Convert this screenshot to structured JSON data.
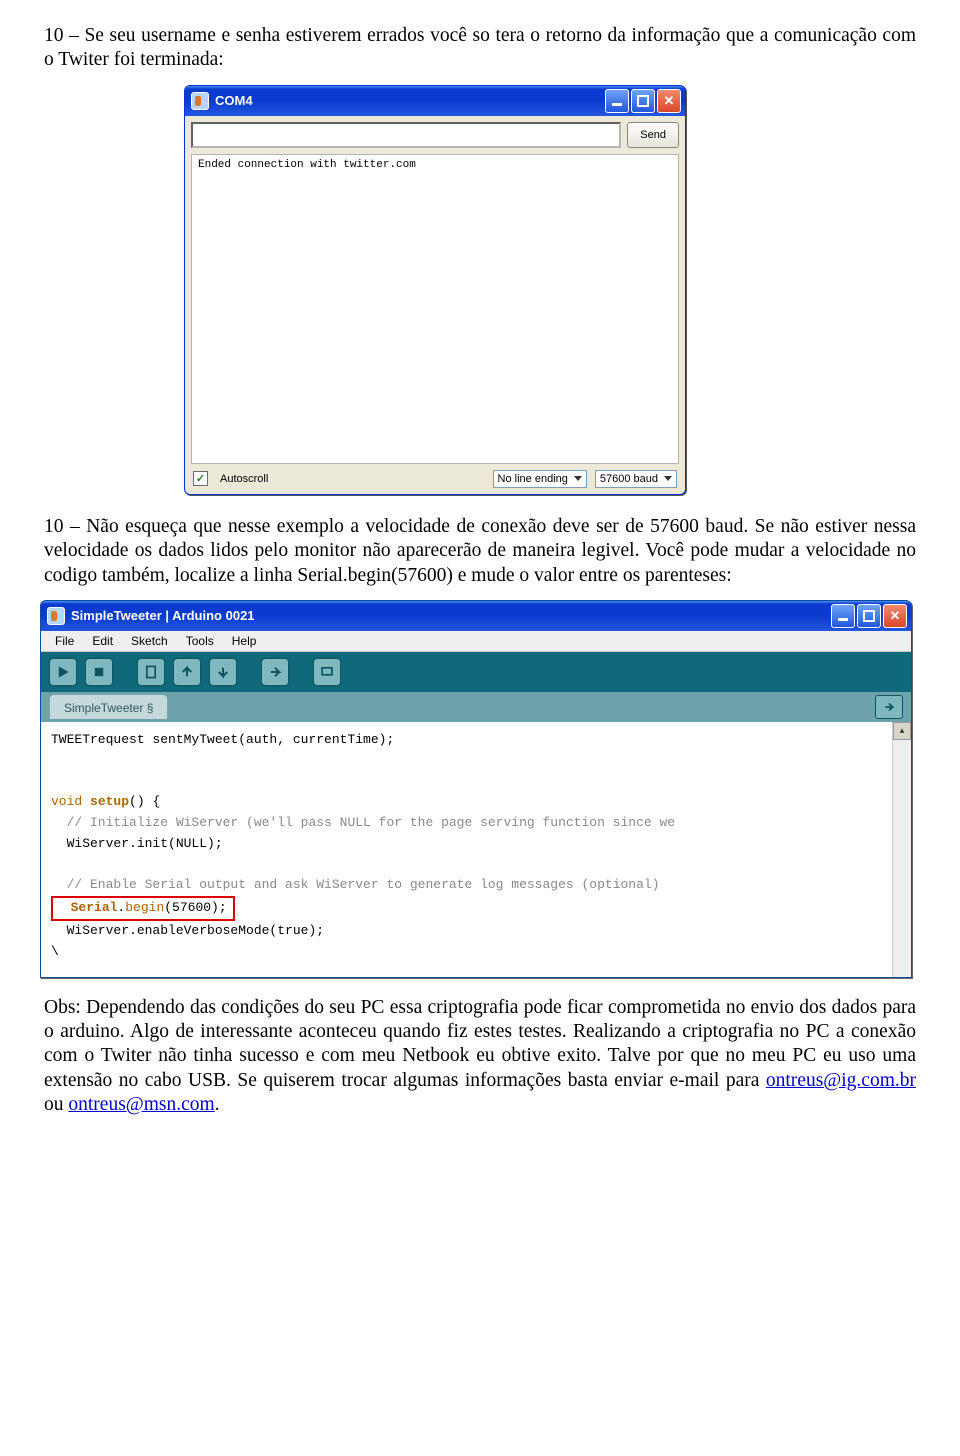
{
  "paragraphs": {
    "p1": "10 – Se seu username e senha estiverem errados você so tera o retorno da informação que a comunicação com o Twiter foi terminada:",
    "p2": "10 – Não esqueça que nesse exemplo a velocidade de conexão deve ser de 57600 baud. Se não estiver nessa velocidade os dados lidos pelo monitor não aparecerão de maneira legivel. Você pode mudar a velocidade no codigo também, localize a linha Serial.begin(57600) e mude o valor entre os parenteses:",
    "obs_before": "Obs: Dependendo das condições do seu PC essa criptografia pode ficar comprometida no envio dos dados para o arduino. Algo de interessante aconteceu quando fiz estes testes. Realizando a criptografia no PC a conexão com o Twiter não tinha sucesso e com meu Netbook eu obtive exito. Talve por que no meu PC eu uso uma extensão no cabo USB. Se quiserem trocar algumas informações basta enviar e-mail para ",
    "email1": "ontreus@ig.com.br",
    "obs_mid": " ou ",
    "email2": "ontreus@msn.com",
    "obs_end": "."
  },
  "com4": {
    "title": "COM4",
    "send": "Send",
    "console": "Ended connection with twitter.com",
    "autoscroll": "Autoscroll",
    "autoscroll_checked": "✓",
    "line_ending": "No line ending",
    "baud": "57600 baud"
  },
  "ide": {
    "title": "SimpleTweeter | Arduino 0021",
    "menu": {
      "file": "File",
      "edit": "Edit",
      "sketch": "Sketch",
      "tools": "Tools",
      "help": "Help"
    },
    "tab": "SimpleTweeter §",
    "code": {
      "l1": "TWEETrequest sentMyTweet(auth, currentTime);",
      "l2": "",
      "l3": "",
      "l4_a": "void",
      "l4_b": " ",
      "l4_c": "setup",
      "l4_d": "() {",
      "l5": "  // Initialize WiServer (we'll pass NULL for the page serving function since we",
      "l6": "  WiServer.init(NULL);",
      "l7": "",
      "l8": "  // Enable Serial output and ask WiServer to generate log messages (optional)",
      "l9_a": "  ",
      "l9_b": "Serial",
      "l9_c": ".",
      "l9_d": "begin",
      "l9_e": "(57600);",
      "l10": "  WiServer.enableVerboseMode(true);",
      "l11": "\\"
    }
  }
}
